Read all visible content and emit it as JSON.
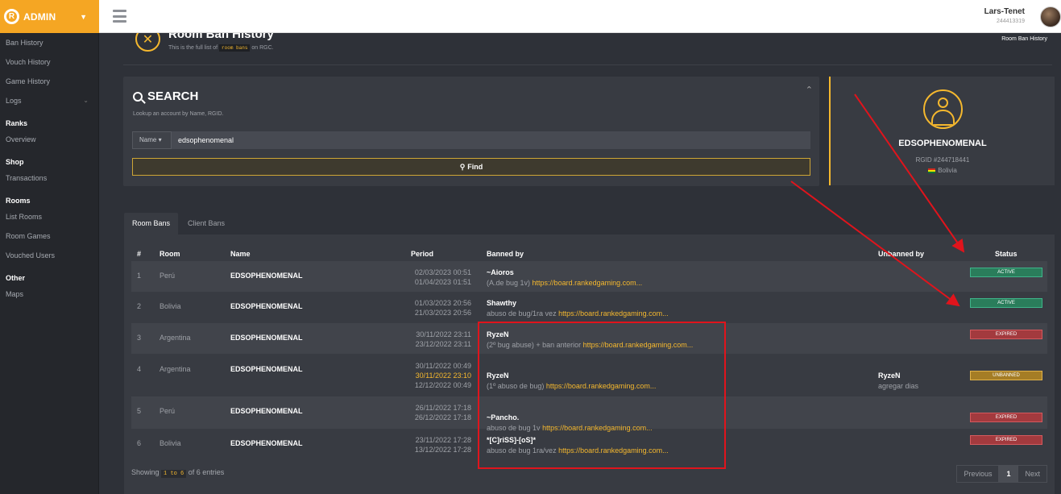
{
  "brand": {
    "logo": "R",
    "label": "ADMIN"
  },
  "user": {
    "name": "Lars-Tenet",
    "id": "244413319"
  },
  "sidebar": {
    "items": [
      {
        "label": "Ban History"
      },
      {
        "label": "Vouch History"
      },
      {
        "label": "Game History"
      },
      {
        "label": "Logs"
      }
    ],
    "ranks": {
      "heading": "Ranks",
      "items": [
        {
          "label": "Overview"
        }
      ]
    },
    "shop": {
      "heading": "Shop",
      "items": [
        {
          "label": "Transactions"
        }
      ]
    },
    "rooms": {
      "heading": "Rooms",
      "items": [
        {
          "label": "List Rooms"
        },
        {
          "label": "Room Games"
        },
        {
          "label": "Vouched Users"
        }
      ]
    },
    "other": {
      "heading": "Other",
      "items": [
        {
          "label": "Maps"
        }
      ]
    }
  },
  "page": {
    "title": "Room Ban History",
    "subtitle_pre": "This is the full list of",
    "subtitle_code": "room bans",
    "subtitle_post": "on RGC.",
    "breadcrumb": "Room Ban History"
  },
  "search": {
    "title": "SEARCH",
    "subtitle": "Lookup an account by Name, RGID.",
    "type_selected": "Name",
    "value": "edsophenomenal",
    "button": "Find"
  },
  "profile": {
    "name": "EDSOPHENOMENAL",
    "rgid": "RGID #244718441",
    "country": "Bolivia"
  },
  "tabs": [
    {
      "label": "Room Bans"
    },
    {
      "label": "Client Bans"
    }
  ],
  "table": {
    "headers": [
      "#",
      "Room",
      "Name",
      "Period",
      "Banned by",
      "Unbanned by",
      "Status"
    ],
    "rows": [
      {
        "num": "1",
        "room": "Perú",
        "name": "EDSOPHENOMENAL",
        "p1": "02/03/2023 00:51",
        "p2": "01/04/2023 01:51",
        "p3": "",
        "banned_by": "~Aioros",
        "reason": "(A.de bug 1v)",
        "link": "https://board.rankedgaming.com...",
        "unbanned_by": "",
        "unban_reason": "",
        "status": "ACTIVE"
      },
      {
        "num": "2",
        "room": "Bolivia",
        "name": "EDSOPHENOMENAL",
        "p1": "01/03/2023 20:56",
        "p2": "21/03/2023 20:56",
        "p3": "",
        "banned_by": "Shawthy",
        "reason": "abuso de bug/1ra vez",
        "link": "https://board.rankedgaming.com...",
        "unbanned_by": "",
        "unban_reason": "",
        "status": "ACTIVE"
      },
      {
        "num": "3",
        "room": "Argentina",
        "name": "EDSOPHENOMENAL",
        "p1": "30/11/2022 23:11",
        "p2": "23/12/2022 23:11",
        "p3": "",
        "banned_by": "RyzeN",
        "reason": "(2º bug abuse) + ban anterior",
        "link": "https://board.rankedgaming.com...",
        "unbanned_by": "",
        "unban_reason": "",
        "status": "EXPIRED"
      },
      {
        "num": "4",
        "room": "Argentina",
        "name": "EDSOPHENOMENAL",
        "p1": "30/11/2022 00:49",
        "p2": "30/11/2022 23:10",
        "p3": "12/12/2022 00:49",
        "banned_by": "RyzeN",
        "reason": "(1º abuso de bug)",
        "link": "https://board.rankedgaming.com...",
        "unbanned_by": "RyzeN",
        "unban_reason": "agregar dias",
        "status": "UNBANNED"
      },
      {
        "num": "5",
        "room": "Perú",
        "name": "EDSOPHENOMENAL",
        "p1": "26/11/2022 17:18",
        "p2": "26/12/2022 17:18",
        "p3": "",
        "banned_by": "~Pancho.",
        "reason": "abuso de bug 1v",
        "link": "https://board.rankedgaming.com...",
        "unbanned_by": "",
        "unban_reason": "",
        "status": "EXPIRED"
      },
      {
        "num": "6",
        "room": "Bolivia",
        "name": "EDSOPHENOMENAL",
        "p1": "23/11/2022 17:28",
        "p2": "13/12/2022 17:28",
        "p3": "",
        "banned_by": "*[C]riSS]-[oS]*",
        "reason": "abuso de bug 1ra/vez",
        "link": "https://board.rankedgaming.com...",
        "unbanned_by": "",
        "unban_reason": "",
        "status": "EXPIRED"
      }
    ]
  },
  "footer": {
    "showing_pre": "Showing",
    "range": "1 to 6",
    "showing_post": "of 6 entries"
  },
  "pagination": {
    "prev": "Previous",
    "page": "1",
    "next": "Next"
  },
  "colors": {
    "accent": "#f5a623",
    "annotation": "#e0141c",
    "active": "#2a7d5b",
    "expired": "#a33a3e",
    "unbanned": "#a57d25"
  }
}
